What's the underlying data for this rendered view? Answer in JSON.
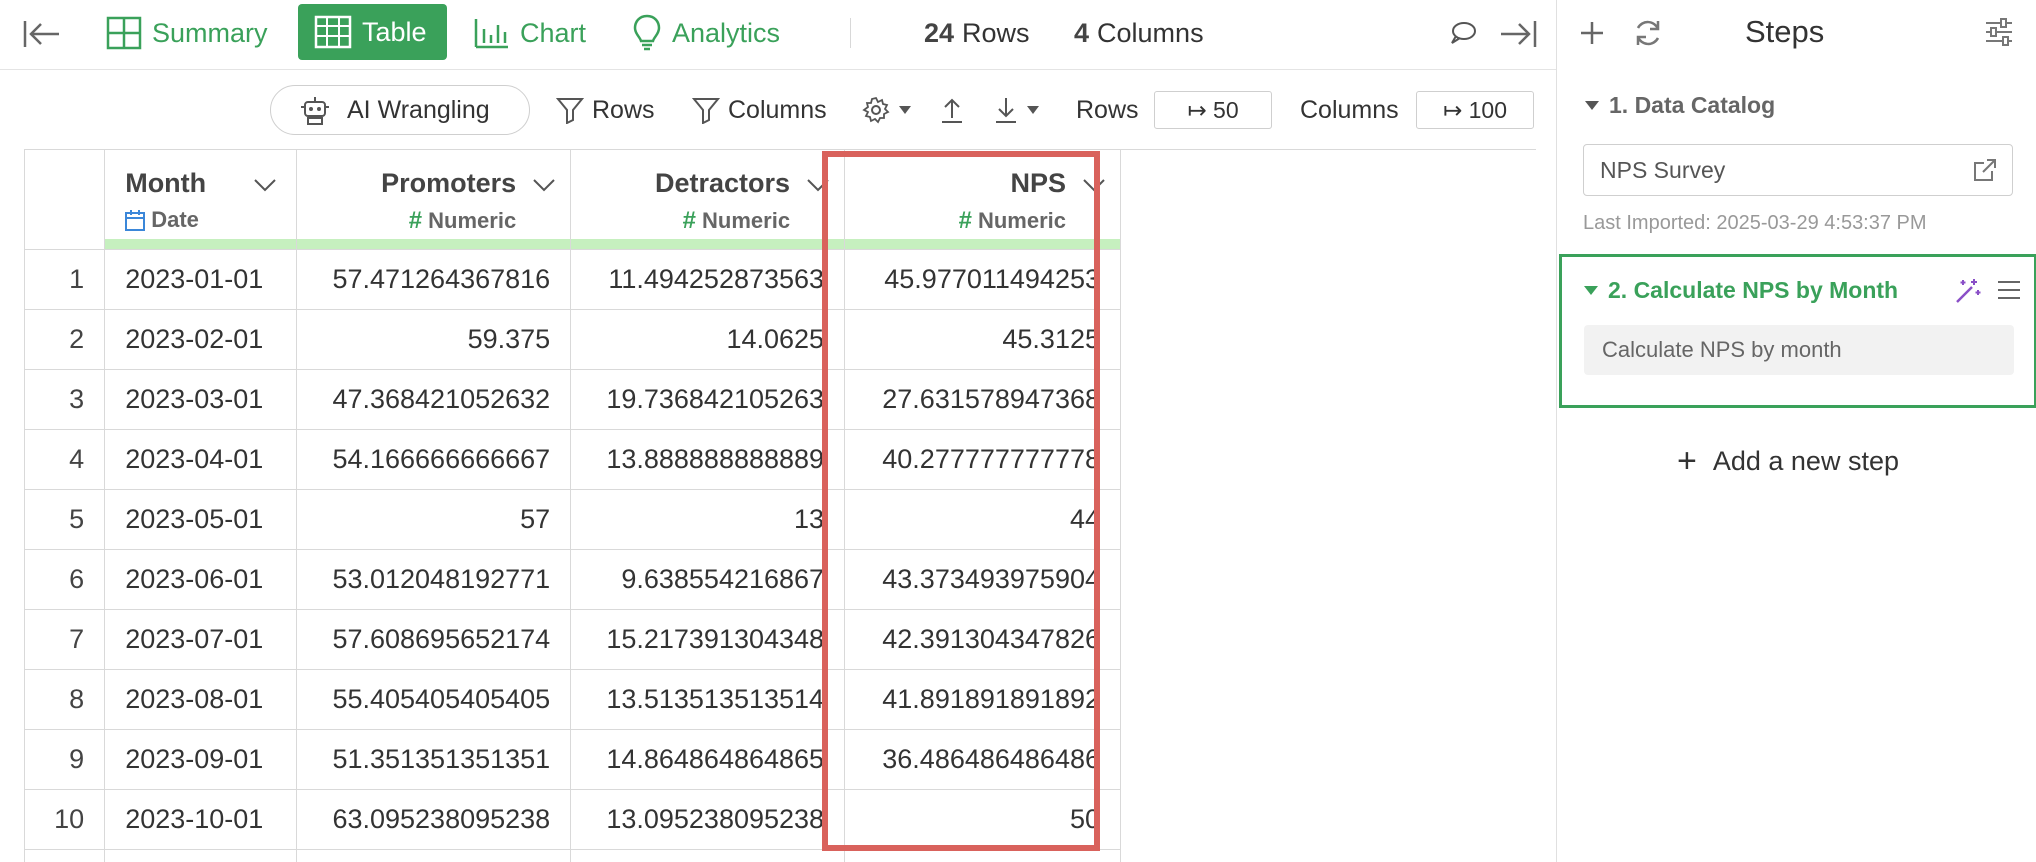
{
  "toolbar": {
    "summary_label": "Summary",
    "table_label": "Table",
    "chart_label": "Chart",
    "analytics_label": "Analytics",
    "rows_count": "24",
    "rows_label": "Rows",
    "columns_count": "4",
    "columns_label": "Columns"
  },
  "toolbar2": {
    "ai_label": "AI Wrangling",
    "rows_filter_label": "Rows",
    "columns_filter_label": "Columns",
    "rows_label": "Rows",
    "rows_value": "↦ 50",
    "columns_label": "Columns",
    "columns_value": "↦ 100"
  },
  "table": {
    "columns": [
      {
        "name": "Month",
        "type": "Date"
      },
      {
        "name": "Promoters",
        "type": "Numeric"
      },
      {
        "name": "Detractors",
        "type": "Numeric"
      },
      {
        "name": "NPS",
        "type": "Numeric"
      }
    ],
    "rows": [
      {
        "n": "1",
        "month": "2023-01-01",
        "promoters": "57.471264367816",
        "detractors": "11.494252873563",
        "nps": "45.977011494253"
      },
      {
        "n": "2",
        "month": "2023-02-01",
        "promoters": "59.375",
        "detractors": "14.0625",
        "nps": "45.3125"
      },
      {
        "n": "3",
        "month": "2023-03-01",
        "promoters": "47.368421052632",
        "detractors": "19.736842105263",
        "nps": "27.631578947368"
      },
      {
        "n": "4",
        "month": "2023-04-01",
        "promoters": "54.166666666667",
        "detractors": "13.888888888889",
        "nps": "40.277777777778"
      },
      {
        "n": "5",
        "month": "2023-05-01",
        "promoters": "57",
        "detractors": "13",
        "nps": "44"
      },
      {
        "n": "6",
        "month": "2023-06-01",
        "promoters": "53.012048192771",
        "detractors": "9.638554216867",
        "nps": "43.373493975904"
      },
      {
        "n": "7",
        "month": "2023-07-01",
        "promoters": "57.608695652174",
        "detractors": "15.217391304348",
        "nps": "42.391304347826"
      },
      {
        "n": "8",
        "month": "2023-08-01",
        "promoters": "55.405405405405",
        "detractors": "13.513513513514",
        "nps": "41.891891891892"
      },
      {
        "n": "9",
        "month": "2023-09-01",
        "promoters": "51.351351351351",
        "detractors": "14.864864864865",
        "nps": "36.486486486486"
      },
      {
        "n": "10",
        "month": "2023-10-01",
        "promoters": "63.095238095238",
        "detractors": "13.095238095238",
        "nps": "50"
      }
    ]
  },
  "panel": {
    "title": "Steps",
    "step1_title": "1. Data Catalog",
    "catalog_name": "NPS Survey",
    "last_imported": "Last Imported: 2025-03-29 4:53:37 PM",
    "step2_title": "2. Calculate NPS by Month",
    "step2_desc": "Calculate NPS by month",
    "add_step_label": "Add a new step"
  },
  "colors": {
    "accent": "#3aa15a",
    "highlight": "#d9625c",
    "type_bar": "#c6f0bf",
    "magic": "#8a4fc7",
    "date_icon": "#3b87d9"
  }
}
